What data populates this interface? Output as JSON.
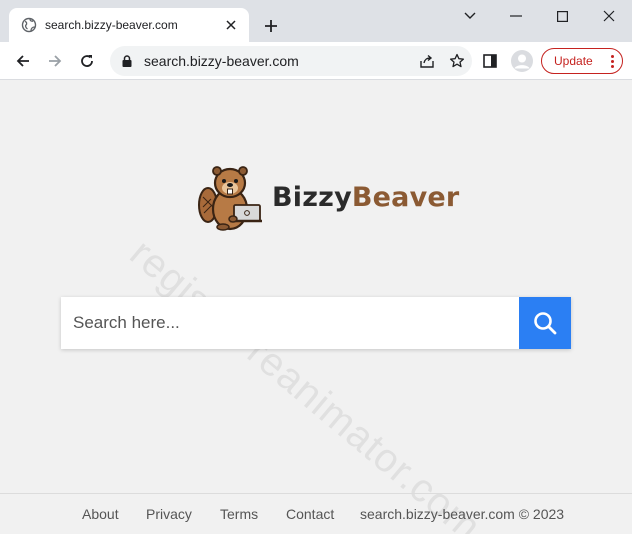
{
  "browser": {
    "tab_title": "search.bizzy-beaver.com",
    "url": "search.bizzy-beaver.com",
    "update_label": "Update"
  },
  "brand": {
    "part1": "Bizzy",
    "part2": "Beaver",
    "color_dark": "#2b2b2b",
    "color_brown": "#8b5a33"
  },
  "search": {
    "placeholder": "Search here...",
    "button_color": "#2b7ff3"
  },
  "watermark": "registry-reanimator.com",
  "footer": {
    "about": "About",
    "privacy": "Privacy",
    "terms": "Terms",
    "contact": "Contact",
    "copyright": "search.bizzy-beaver.com © 2023"
  }
}
